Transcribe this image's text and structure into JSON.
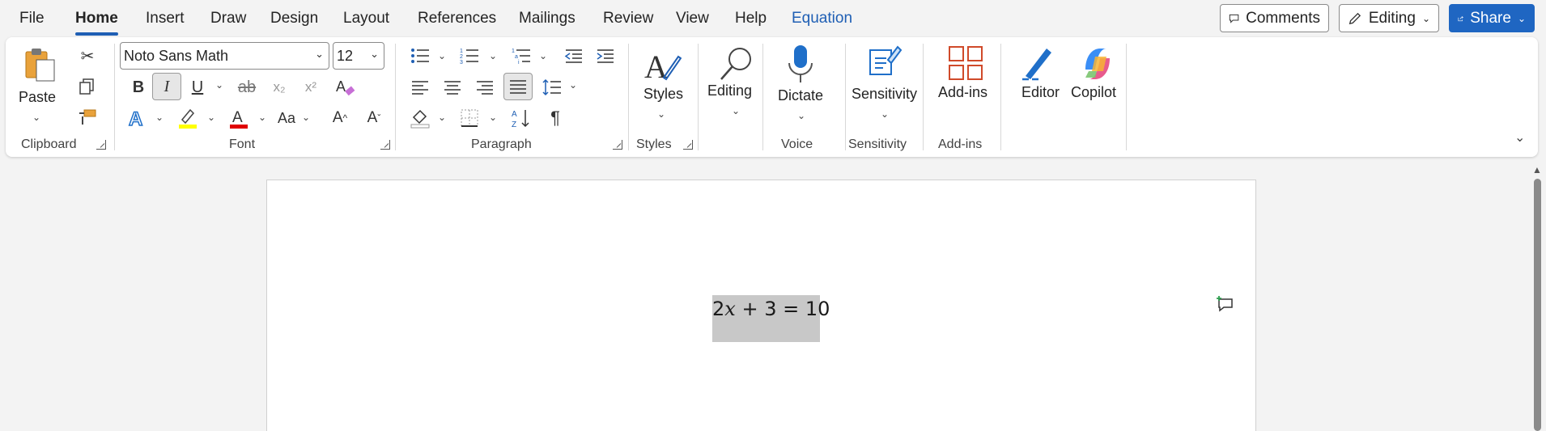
{
  "menu": {
    "tabs": [
      "File",
      "Home",
      "Insert",
      "Draw",
      "Design",
      "Layout",
      "References",
      "Mailings",
      "Review",
      "View",
      "Help",
      "Equation"
    ],
    "comments": "Comments",
    "editing": "Editing",
    "share": "Share"
  },
  "ribbon": {
    "clipboard": {
      "paste": "Paste",
      "label": "Clipboard"
    },
    "font": {
      "name": "Noto Sans Math",
      "size": "12",
      "label": "Font",
      "bold": "B",
      "italic": "I",
      "underline": "U",
      "strike": "ab",
      "subscript": "x₂",
      "superscript": "x²",
      "case": "Aa",
      "grow": "A^",
      "shrink": "Aˇ"
    },
    "paragraph": {
      "label": "Paragraph"
    },
    "styles": {
      "button": "Styles",
      "label": "Styles"
    },
    "editing": {
      "button": "Editing"
    },
    "voice": {
      "button": "Dictate",
      "label": "Voice"
    },
    "sensitivity": {
      "button": "Sensitivity",
      "label": "Sensitivity"
    },
    "addins": {
      "button": "Add-ins",
      "label": "Add-ins"
    },
    "editor": {
      "button": "Editor"
    },
    "copilot": {
      "button": "Copilot"
    }
  },
  "document": {
    "equation_prefix": "2",
    "equation_var": "x",
    "equation_suffix": " + 3 = 10"
  },
  "colors": {
    "accent": "#1f5fb4",
    "highlight": "#ffff00",
    "font_color": "#e00000",
    "selection": "#c8c8c8"
  }
}
